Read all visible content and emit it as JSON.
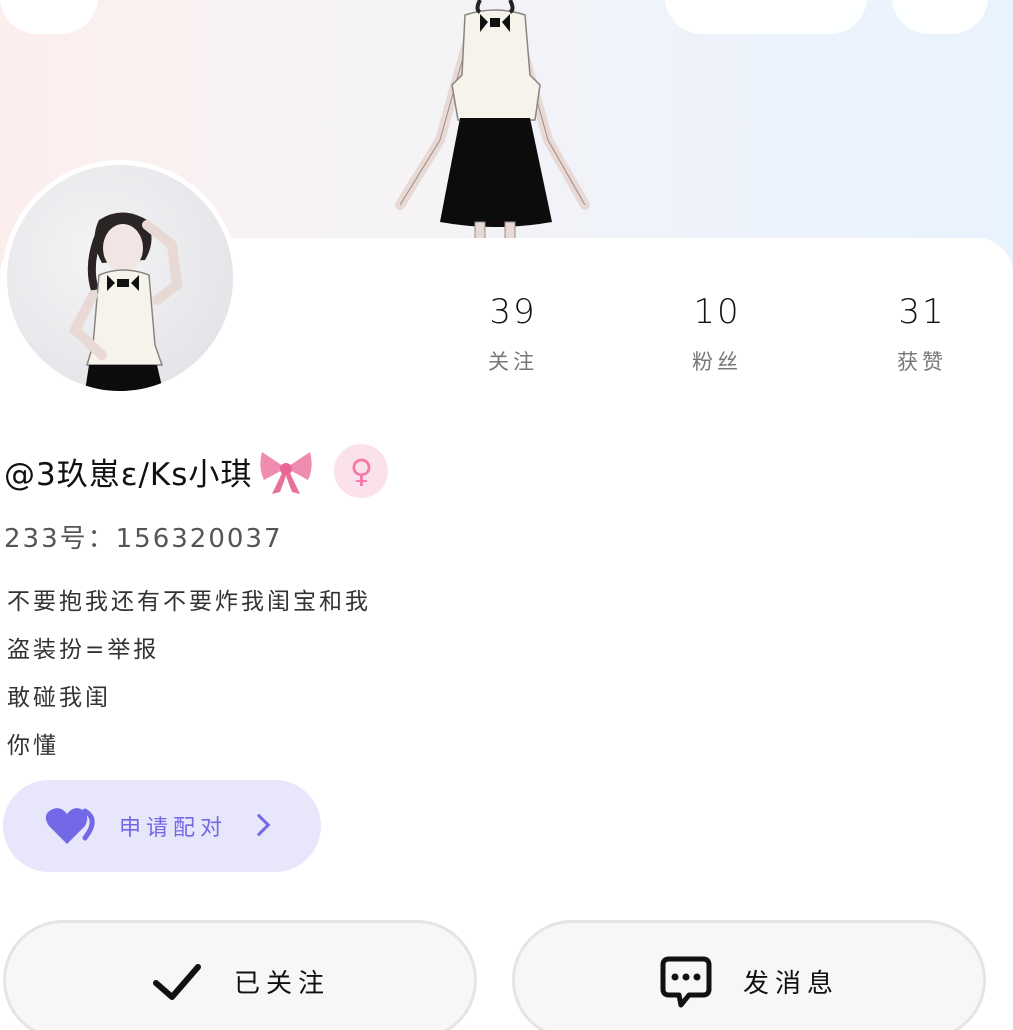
{
  "header": {
    "back_icon": "chevron-left-icon",
    "more_icon": "more-icon"
  },
  "profile": {
    "username": "@3玖崽ɛ/Ks小琪",
    "gender_symbol": "♀",
    "uid_label": "233号：",
    "uid_value": "156320037",
    "stats": [
      {
        "value": "39",
        "label": "关注"
      },
      {
        "value": "10",
        "label": "粉丝"
      },
      {
        "value": "31",
        "label": "获赞"
      }
    ],
    "bio": [
      "不要抱我还有不要炸我闺宝和我",
      "盗装扮=举报",
      "敢碰我闺",
      "你懂"
    ]
  },
  "pair_button": {
    "label": "申请配对"
  },
  "actions": {
    "follow_label": "已关注",
    "message_label": "发消息"
  },
  "colors": {
    "accent": "#7369e6",
    "pair_bg": "#e8e6fb",
    "gender_pink": "#f47aa6"
  }
}
